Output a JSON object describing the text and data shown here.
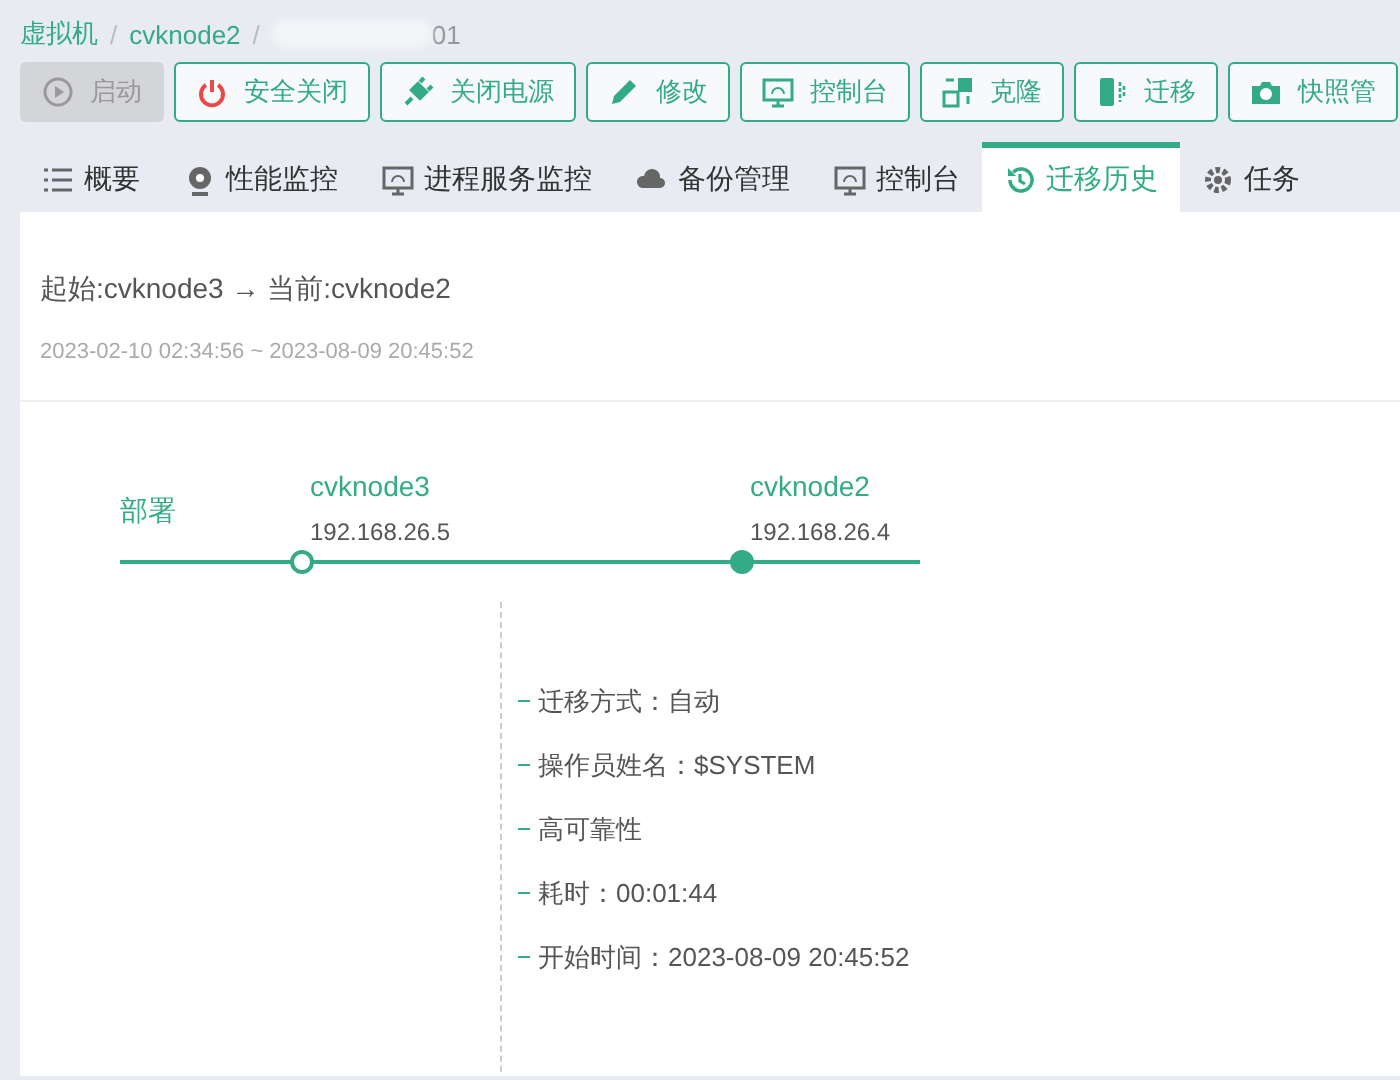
{
  "breadcrumb": [
    {
      "label": "虚拟机",
      "kind": "link"
    },
    {
      "separator": "/",
      "label": "cvknode2",
      "kind": "link"
    },
    {
      "separator": "/",
      "label": "01",
      "kind": "redacted"
    }
  ],
  "toolbar": [
    {
      "label": "启动",
      "disabled": true
    },
    {
      "label": "安全关闭",
      "disabled": false
    },
    {
      "label": "关闭电源",
      "disabled": false
    },
    {
      "label": "修改",
      "disabled": false
    },
    {
      "label": "控制台",
      "disabled": false
    },
    {
      "label": "克隆",
      "disabled": false
    },
    {
      "label": "迁移",
      "disabled": false
    },
    {
      "label": "快照管",
      "disabled": false
    }
  ],
  "tabs": [
    {
      "label": "概要",
      "selected": false
    },
    {
      "label": "性能监控",
      "selected": false
    },
    {
      "label": "进程服务监控",
      "selected": false
    },
    {
      "label": "备份管理",
      "selected": false
    },
    {
      "label": "控制台",
      "selected": false
    },
    {
      "label": "迁移历史",
      "selected": true
    },
    {
      "label": "任务",
      "selected": false
    }
  ],
  "migration": {
    "title": "起始:cvknode3 → 当前:cvknode2",
    "period": "2023-02-10 02:34:56 ~ 2023-08-09 20:45:52",
    "stage": "部署",
    "nodes": [
      {
        "name": "cvknode3",
        "ip": "192.168.26.5",
        "current": false
      },
      {
        "name": "cvknode2",
        "ip": "192.168.26.4",
        "current": true
      }
    ],
    "details": [
      "迁移方式：自动",
      "操作员姓名：$SYSTEM",
      "高可靠性",
      "耗时：00:01:44",
      "开始时间：2023-08-09 20:45:52"
    ]
  }
}
